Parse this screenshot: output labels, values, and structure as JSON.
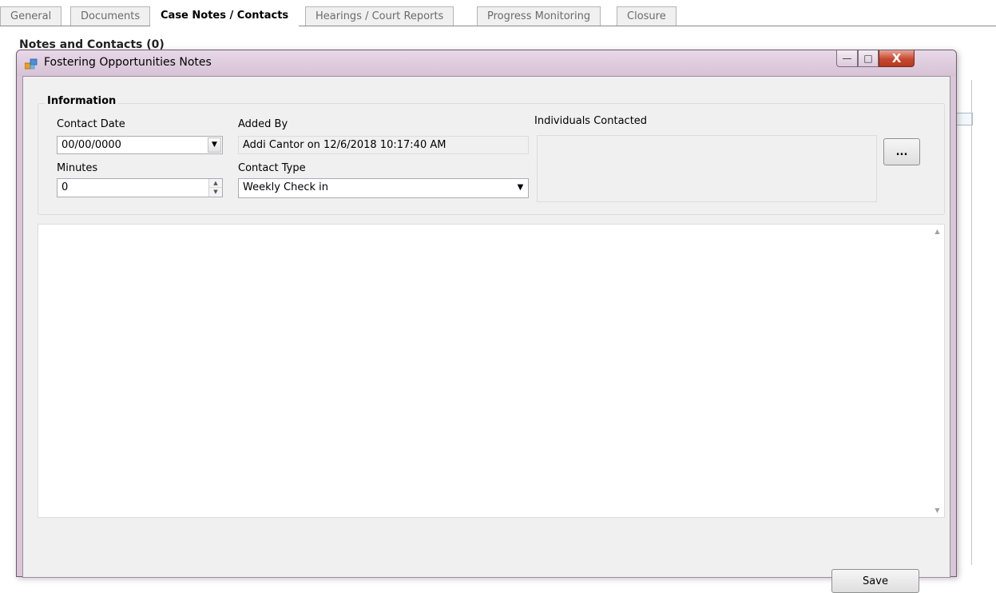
{
  "tabs": [
    {
      "label": "General",
      "active": false
    },
    {
      "label": "Documents",
      "active": false
    },
    {
      "label": "Case Notes / Contacts",
      "active": true
    },
    {
      "label": "Hearings / Court Reports",
      "active": false
    },
    {
      "label": "Progress Monitoring",
      "active": false
    },
    {
      "label": "Closure",
      "active": false
    }
  ],
  "background": {
    "section_heading": "Notes and Contacts (0)"
  },
  "dialog": {
    "title": "Fostering Opportunities Notes",
    "window_buttons": {
      "minimize_glyph": "—",
      "maximize_glyph": "□",
      "close_glyph": "X"
    },
    "information": {
      "group_title": "Information",
      "contact_date": {
        "label": "Contact Date",
        "value": "00/00/0000"
      },
      "minutes": {
        "label": "Minutes",
        "value": "0"
      },
      "added_by": {
        "label": "Added By",
        "value": "Addi Cantor on 12/6/2018 10:17:40 AM"
      },
      "contact_type": {
        "label": "Contact Type",
        "value": "Weekly Check in"
      },
      "individuals_contacted": {
        "label": "Individuals Contacted",
        "value": "",
        "browse_label": "..."
      }
    },
    "notes": {
      "value": ""
    },
    "save_label": "Save"
  },
  "colors": {
    "titlebar": "#d9c6d8",
    "close_button": "#c6482f",
    "client_background": "#f0f0f0"
  }
}
